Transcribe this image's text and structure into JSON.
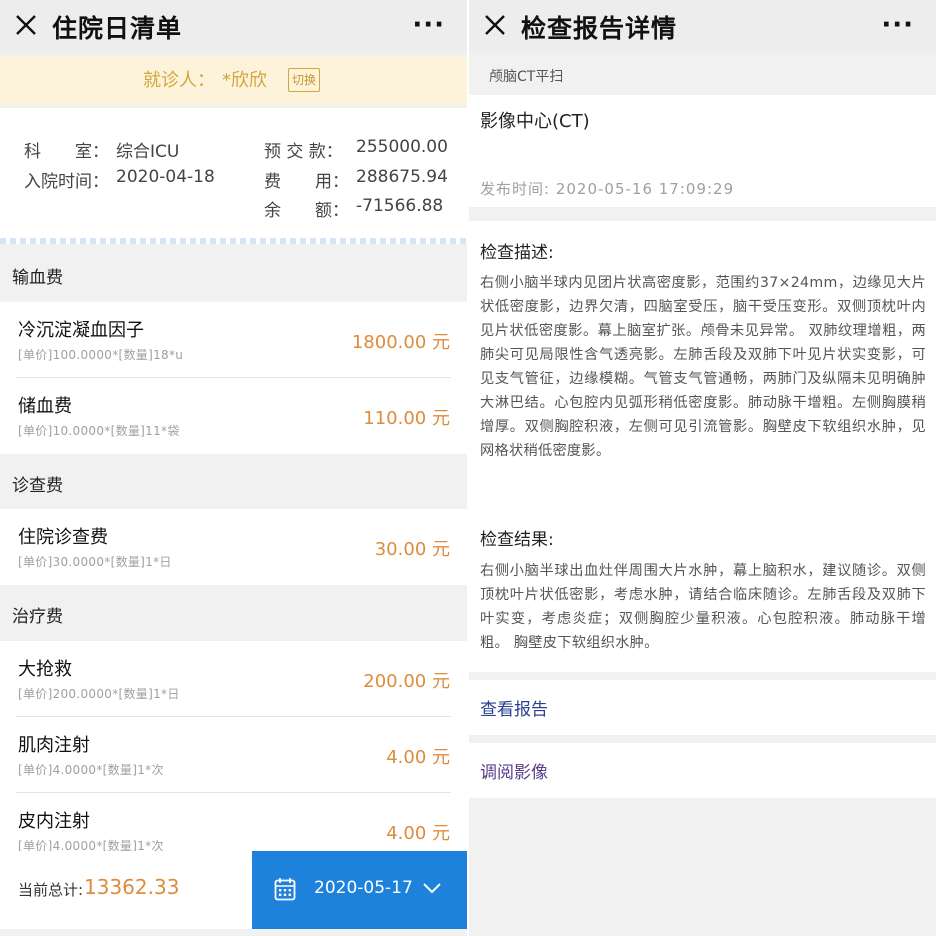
{
  "left": {
    "nav": {
      "title": "住院日清单",
      "more": "···"
    },
    "patient": {
      "label": "就诊人：",
      "name": "*欣欣",
      "switch_label": "切换"
    },
    "info": {
      "dept_label": "科　　室：",
      "dept_value": "综合ICU",
      "admit_label": "入院时间：",
      "admit_value": "2020-04-18",
      "deposit_label": "预 交 款：",
      "deposit_value": "255000.00",
      "cost_label": "费　　用：",
      "cost_value": "288675.94",
      "balance_label": "余　　额：",
      "balance_value": "-71566.88"
    },
    "sections": [
      {
        "title": "输血费",
        "items": [
          {
            "name": "冷沉淀凝血因子",
            "detail": "[单价]100.0000*[数量]18*u",
            "price": "1800.00 元"
          },
          {
            "name": "储血费",
            "detail": "[单价]10.0000*[数量]11*袋",
            "price": "110.00 元"
          }
        ]
      },
      {
        "title": "诊查费",
        "items": [
          {
            "name": "住院诊查费",
            "detail": "[单价]30.0000*[数量]1*日",
            "price": "30.00 元"
          }
        ]
      },
      {
        "title": "治疗费",
        "items": [
          {
            "name": "大抢救",
            "detail": "[单价]200.0000*[数量]1*日",
            "price": "200.00 元"
          },
          {
            "name": "肌肉注射",
            "detail": "[单价]4.0000*[数量]1*次",
            "price": "4.00 元"
          },
          {
            "name": "皮内注射",
            "detail": "[单价]4.0000*[数量]1*次",
            "price": "4.00 元"
          }
        ]
      }
    ],
    "footer": {
      "total_label": "当前总计:",
      "total_value": "13362.33",
      "date": "2020-05-17"
    },
    "icons": {
      "close": "close-icon",
      "calendar": "calendar-icon",
      "chevron": "chevron-down-icon"
    }
  },
  "right": {
    "nav": {
      "title": "检查报告详情",
      "more": "···"
    },
    "exam_type": "颅脑CT平扫",
    "center": "影像中心(CT)",
    "publish": "发布时间:  2020-05-16 17:09:29",
    "description_title": "检查描述:",
    "description": "右侧小脑半球内见团片状高密度影，范围约37×24mm，边缘见大片状低密度影，边界欠清，四脑室受压，脑干受压变形。双侧顶枕叶内见片状低密度影。幕上脑室扩张。颅骨未见异常。 双肺纹理增粗，两肺尖可见局限性含气透亮影。左肺舌段及双肺下叶见片状实变影，可见支气管征，边缘模糊。气管支气管通畅，两肺门及纵隔未见明确肿大淋巴结。心包腔内见弧形稍低密度影。肺动脉干增粗。左侧胸膜稍增厚。双侧胸腔积液，左侧可见引流管影。胸壁皮下软组织水肿，见网格状稍低密度影。",
    "result_title": "检查结果:",
    "result": "右侧小脑半球出血灶伴周围大片水肿，幕上脑积水，建议随诊。双侧顶枕叶片状低密影，考虑水肿，请结合临床随诊。左肺舌段及双肺下叶实变，考虑炎症；双侧胸腔少量积液。心包腔积液。肺动脉干增粗。 胸壁皮下软组织水肿。",
    "links": [
      {
        "label": "查看报告",
        "color": "#2b3f8f"
      },
      {
        "label": "调阅影像",
        "color": "#5a3b8a"
      }
    ]
  },
  "colors": {
    "accent_orange": "#dd8c3c",
    "primary_blue": "#1e82dc",
    "patient_gold": "#d4a63a"
  }
}
